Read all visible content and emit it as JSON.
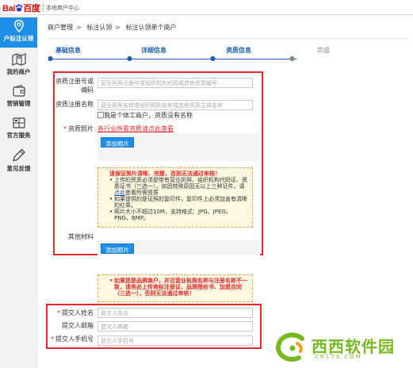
{
  "header": {
    "logo_text": "Bai百度",
    "title": "本地商户中心"
  },
  "sidebar": {
    "items": [
      {
        "label": "户标注认领",
        "icon": "location-pin-icon",
        "active": true
      },
      {
        "label": "我的商户",
        "icon": "map-icon",
        "active": false
      },
      {
        "label": "营销管理",
        "icon": "wallet-icon",
        "active": false
      },
      {
        "label": "官方服务",
        "icon": "service-icon",
        "active": false
      },
      {
        "label": "意见反馈",
        "icon": "pencil-icon",
        "active": false
      }
    ]
  },
  "breadcrumb": {
    "items": [
      "商户管理",
      "标注认领",
      "标注认领单个商户"
    ],
    "separator": ">"
  },
  "steps": {
    "items": [
      {
        "label": "基础信息",
        "done": true
      },
      {
        "label": "详细信息",
        "done": true
      },
      {
        "label": "资质信息",
        "done": true
      },
      {
        "label": "完成",
        "done": false
      }
    ],
    "dot_glyph": "●"
  },
  "form": {
    "reg_no": {
      "label": "资质注册号或编码",
      "placeholder": "营业执照注册号或组织机构代码或其他资质编号"
    },
    "reg_name": {
      "label": "资质注册名称",
      "placeholder": "营业执照名称或组织机构名称或其他资质主体名称"
    },
    "individual_check_label": "我是个体工商户，资质没有名称",
    "photos": {
      "label": "资质照片",
      "link": "各行业所需资质请点此查看",
      "add_button": "添加照片"
    },
    "photo_notice": {
      "headline": "请保证照片清晰、完整，否则无法通过审核！",
      "items": [
        "上传的资质必须是带有营业执照、组织机构代码证、资质证书（三选一），如因特殊原因无以上三种证件，请",
        "点此",
        "查看所需资质",
        "如果提供的是证照的复印件，复印件上必须加盖有清晰的红章。",
        "照片大小不超过10M，支持格式：JPG、JPEG、PNG、BMP。"
      ]
    },
    "other": {
      "label": "其他材料",
      "add_button": "添加照片"
    },
    "brand_notice": "如果您是品牌商户，并且营业执照名称与注册名称不一致，请务必上传商标注册证、品牌授权书、加盟合同（三选一），否则无法通过审核！",
    "submitter_name": {
      "label": "提交人姓名",
      "placeholder": "提交人姓名",
      "required": true
    },
    "submitter_email": {
      "label": "提交人邮箱",
      "placeholder": "提交人邮箱",
      "required": false
    },
    "submitter_phone": {
      "label": "提交人手机号",
      "placeholder": "提交人手机号",
      "required": true
    }
  },
  "watermark": {
    "text": "西西软件园",
    "url": "CR173.COM"
  },
  "colors": {
    "accent_blue": "#1e8ee6",
    "step_blue": "#1e5fb4",
    "highlight_red": "#e8282b",
    "notice_bg": "#fff8e1",
    "watermark_green": "#78b823"
  }
}
